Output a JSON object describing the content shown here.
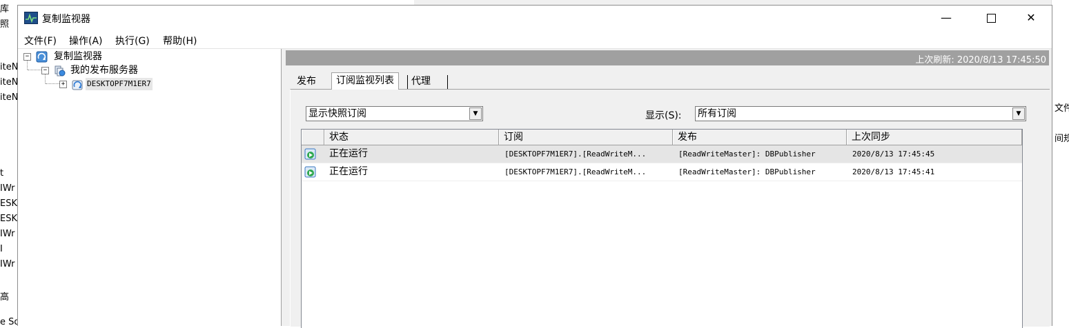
{
  "background": {
    "left_fragments": [
      "库",
      "照",
      "iteN",
      "iteN",
      "iteN",
      "t",
      "IWr",
      "ESK",
      "ESK",
      "IWr",
      "I",
      "IWr",
      "高",
      "e So"
    ],
    "right_fragments": [
      "文件",
      "间规"
    ]
  },
  "window": {
    "title": "复制监视器",
    "controls": {
      "minimize": "—",
      "close": "✕"
    }
  },
  "menu": [
    "文件(F)",
    "操作(A)",
    "执行(G)",
    "帮助(H)"
  ],
  "tree": {
    "root": "复制监视器",
    "publishers": "我的发布服务器",
    "server": "DESKTOPF7M1ER7"
  },
  "refresh": {
    "text": "上次刷新: 2020/8/13 17:45:50"
  },
  "tabs": [
    "发布",
    "订阅监视列表",
    "代理"
  ],
  "filter": {
    "left_value": "显示快照订阅",
    "show_label": "显示(S):",
    "show_value": "所有订阅"
  },
  "table": {
    "columns": [
      "状态",
      "订阅",
      "发布",
      "上次同步"
    ],
    "rows": [
      {
        "status": "正在运行",
        "subscription": "[DESKTOPF7M1ER7].[ReadWriteM...",
        "publication": "[ReadWriteMaster]: DBPublisher",
        "last_sync": "2020/8/13 17:45:45"
      },
      {
        "status": "正在运行",
        "subscription": "[DESKTOPF7M1ER7].[ReadWriteM...",
        "publication": "[ReadWriteMaster]: DBPublisher",
        "last_sync": "2020/8/13 17:45:41"
      }
    ]
  },
  "colors": {
    "refresh_bar": "#a0a0a0",
    "title_icon": "#1f4e8a",
    "selected_row": "#e5e5e5"
  }
}
